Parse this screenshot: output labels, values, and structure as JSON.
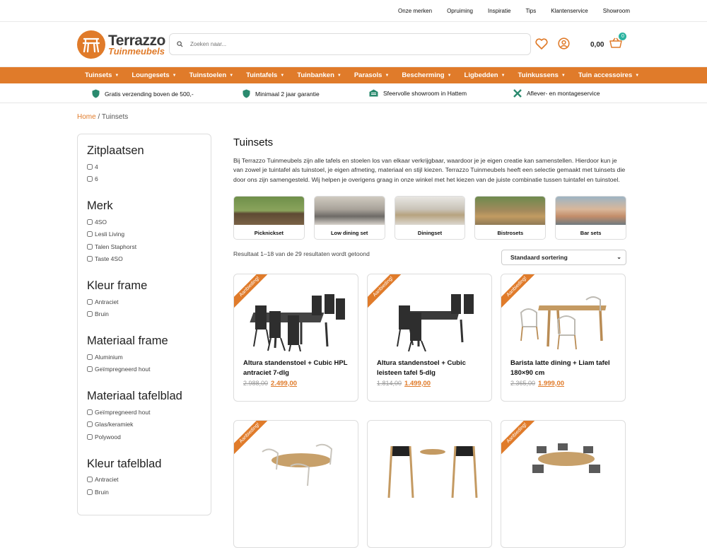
{
  "toplinks": [
    "Onze merken",
    "Opruiming",
    "Inspiratie",
    "Tips",
    "Klantenservice",
    "Showroom"
  ],
  "logo": {
    "line1": "Terrazzo",
    "line2": "Tuinmeubels"
  },
  "search": {
    "placeholder": "Zoeken naar..."
  },
  "cart": {
    "total": "0,00",
    "count": "0"
  },
  "nav": [
    "Tuinsets",
    "Loungesets",
    "Tuinstoelen",
    "Tuintafels",
    "Tuinbanken",
    "Parasols",
    "Bescherming",
    "Ligbedden",
    "Tuinkussens",
    "Tuin accessoires"
  ],
  "usps": [
    "Gratis verzending boven de 500,-",
    "Minimaal 2 jaar garantie",
    "Sfeervolle showroom in Hattem",
    "Aflever- en montageservice"
  ],
  "breadcrumb": {
    "home": "Home",
    "sep": " / ",
    "current": "Tuinsets"
  },
  "filters": [
    {
      "title": "Zitplaatsen",
      "options": [
        "4",
        "6"
      ]
    },
    {
      "title": "Merk",
      "options": [
        "4SO",
        "Lesli Living",
        "Talen Staphorst",
        "Taste 4SO"
      ]
    },
    {
      "title": "Kleur frame",
      "options": [
        "Antraciet",
        "Bruin"
      ]
    },
    {
      "title": "Materiaal frame",
      "options": [
        "Aluminium",
        "Geïmpregneerd hout"
      ]
    },
    {
      "title": "Materiaal tafelblad",
      "options": [
        "Geïmpregneerd hout",
        "Glas/keramiek",
        "Polywood"
      ]
    },
    {
      "title": "Kleur tafelblad",
      "options": [
        "Antraciet",
        "Bruin"
      ]
    }
  ],
  "main": {
    "title": "Tuinsets",
    "intro": "Bij Terrazzo Tuinmeubels zijn alle tafels en stoelen los van elkaar verkrijgbaar, waardoor je je eigen creatie kan samenstellen. Hierdoor kun je van zowel je tuintafel als tuinstoel, je eigen afmeting, materiaal en stijl kiezen. Terrazzo Tuinmeubels heeft een selectie gemaakt met tuinsets die door ons zijn samengesteld. Wij helpen je overigens graag in onze winkel met het kiezen van de juiste combinatie tussen tuintafel en tuinstoel.",
    "categories": [
      "Picknickset",
      "Low dining set",
      "Diningset",
      "Bistrosets",
      "Bar sets"
    ],
    "result_count": "Resultaat 1–18 van de 29 resultaten wordt getoond",
    "sort": "Standaard sortering",
    "ribbon": "Aanbieding!",
    "products": [
      {
        "name": "Altura standenstoel + Cubic HPL antraciet 7-dlg",
        "old": "2.988,00",
        "new": "2.499,00"
      },
      {
        "name": "Altura standenstoel + Cubic leisteen tafel 5-dlg",
        "old": "1.814,00",
        "new": "1.499,00"
      },
      {
        "name": "Barista latte dining + Liam tafel 180×90 cm",
        "old": "2.365,00",
        "new": "1.999,00"
      },
      {
        "name": "",
        "old": "",
        "new": ""
      },
      {
        "name": "",
        "old": "",
        "new": ""
      },
      {
        "name": "",
        "old": "",
        "new": ""
      }
    ]
  },
  "colors": {
    "accent": "#e07b2a",
    "badge": "#2bb3a0"
  }
}
